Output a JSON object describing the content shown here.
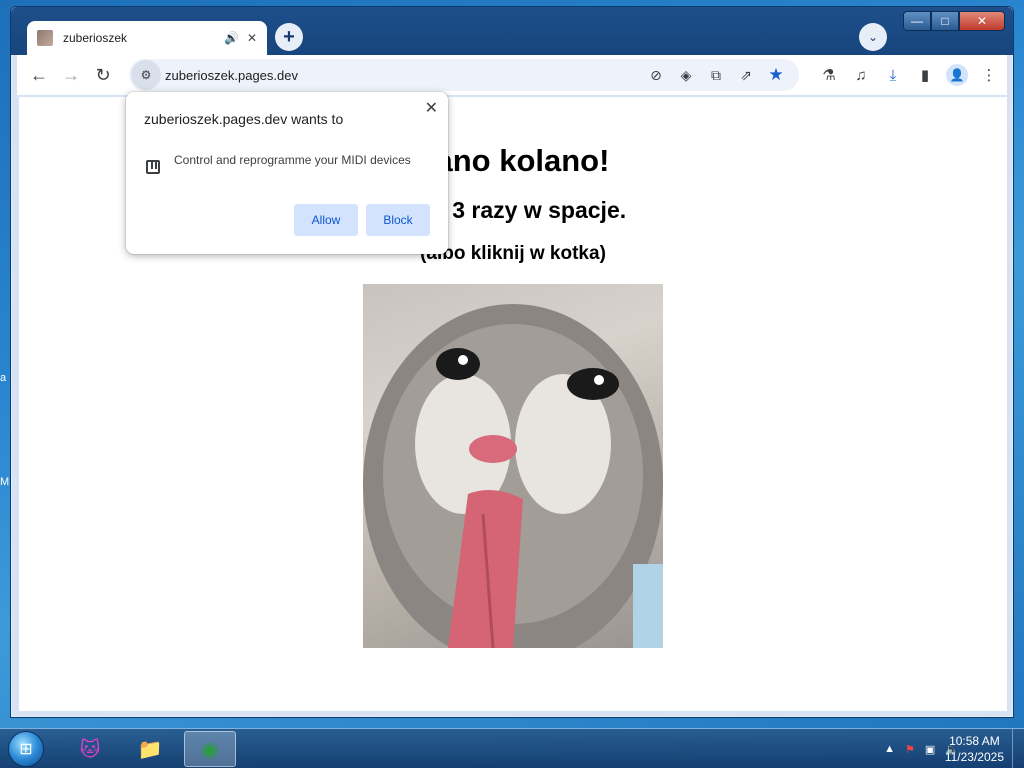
{
  "desktop": {
    "edge_label_1": "a",
    "edge_label_2": "M"
  },
  "browser": {
    "tab": {
      "title": "zuberioszek",
      "audio_icon": "🔊",
      "close_icon": "✕"
    },
    "new_tab_icon": "+",
    "tab_search_icon": "⌄",
    "window_controls": {
      "minimize": "—",
      "maximize": "□",
      "close": "✕"
    },
    "nav": {
      "back": "←",
      "forward": "→",
      "reload": "↻"
    },
    "site_info_icon": "⚙",
    "url": "zuberioszek.pages.dev",
    "omnibox_icons": [
      "⊘",
      "◈",
      "⧉",
      "⇗",
      "★"
    ],
    "toolbar_icons": {
      "labs": "⚗",
      "media": "♫",
      "download": "⤓",
      "sidepanel": "▮",
      "profile": "👤",
      "menu": "⋮"
    }
  },
  "page": {
    "heading": "nano kolano!",
    "subheading": "alnij 3 razy w spacje.",
    "hint": "(albo kliknij w kotka)",
    "image_alt": "kotek"
  },
  "permission_popup": {
    "title": "zuberioszek.pages.dev wants to",
    "close_icon": "✕",
    "item_text": "Control and reprogramme your MIDI devices",
    "allow_label": "Allow",
    "block_label": "Block"
  },
  "taskbar": {
    "start_icon": "⊞",
    "apps": [
      "🐱",
      "📁",
      "◉"
    ],
    "tray": {
      "arrow": "▲",
      "flag": "⚑",
      "network": "▣",
      "volume": "🔈"
    },
    "time": "10:58 AM",
    "date": "11/23/2025"
  }
}
